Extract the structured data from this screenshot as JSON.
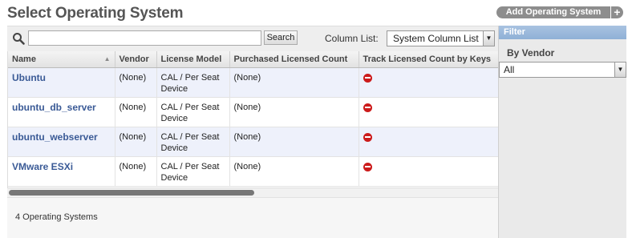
{
  "page": {
    "title": "Select Operating System"
  },
  "actions": {
    "add_os_label": "Add Operating System",
    "add_plus": "+"
  },
  "toolbar": {
    "search_value": "",
    "search_button": "Search",
    "column_list_label": "Column List:",
    "column_list_value": "System Column List"
  },
  "table": {
    "columns": [
      "Name",
      "Vendor",
      "License Model",
      "Purchased Licensed Count",
      "Track Licensed Count by Keys"
    ],
    "rows": [
      {
        "name": "Ubuntu",
        "vendor": "(None)",
        "license_model": "CAL / Per Seat Device",
        "purchased": "(None)",
        "track_icon": "no-entry-icon"
      },
      {
        "name": "ubuntu_db_server",
        "vendor": "(None)",
        "license_model": "CAL / Per Seat Device",
        "purchased": "(None)",
        "track_icon": "no-entry-icon"
      },
      {
        "name": "ubuntu_webserver",
        "vendor": "(None)",
        "license_model": "CAL / Per Seat Device",
        "purchased": "(None)",
        "track_icon": "no-entry-icon"
      },
      {
        "name": "VMware ESXi",
        "vendor": "(None)",
        "license_model": "CAL / Per Seat Device",
        "purchased": "(None)",
        "track_icon": "no-entry-icon"
      }
    ]
  },
  "footer": {
    "count_text": "4 Operating Systems"
  },
  "filter": {
    "header": "Filter",
    "by_vendor_label": "By Vendor",
    "vendor_value": "All"
  },
  "colors": {
    "accent": "#3a5a96",
    "header_blue": "#9bb9dc",
    "no_entry": "#cc1b1b",
    "row_alt": "#eef1fb"
  }
}
